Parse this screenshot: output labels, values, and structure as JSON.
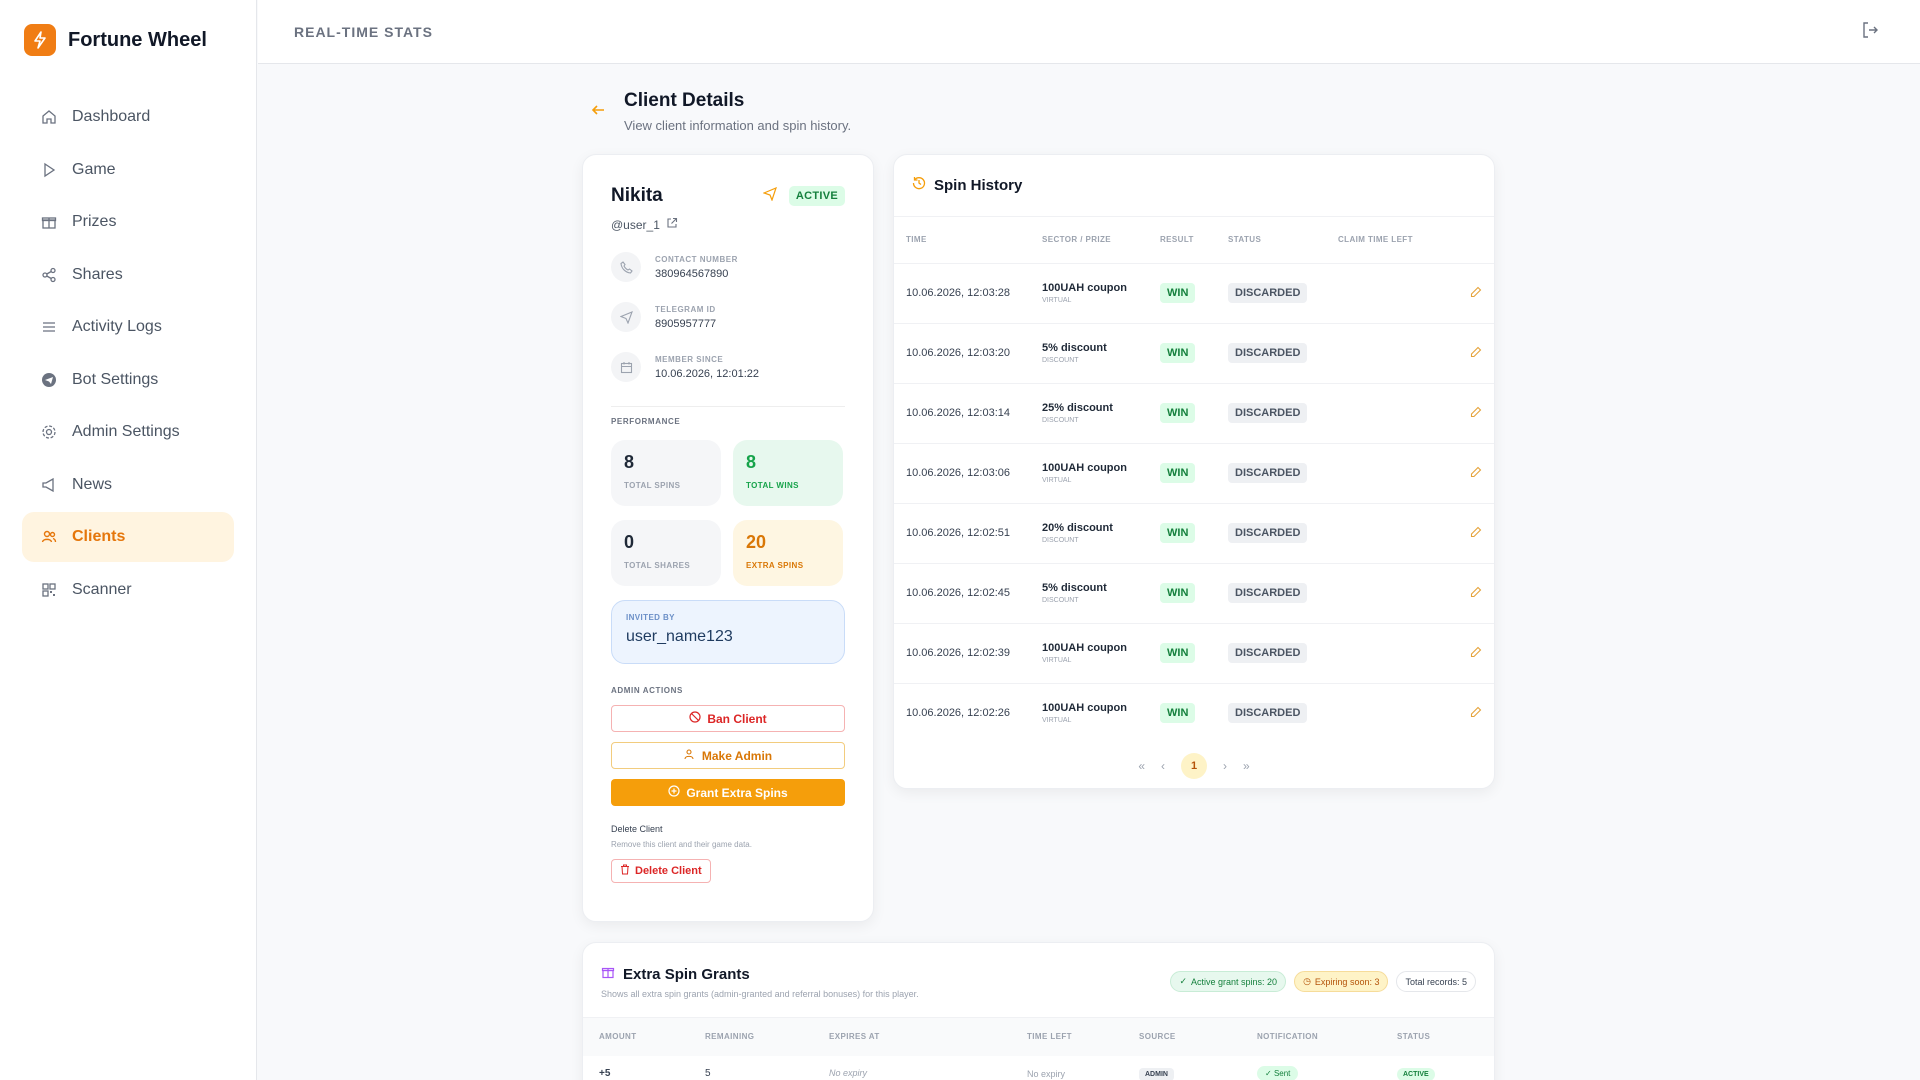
{
  "brand": {
    "name": "Fortune Wheel"
  },
  "sidebar": {
    "items": [
      {
        "label": "Dashboard",
        "icon": "home-icon"
      },
      {
        "label": "Game",
        "icon": "play-icon"
      },
      {
        "label": "Prizes",
        "icon": "gift-icon"
      },
      {
        "label": "Shares",
        "icon": "share-icon"
      },
      {
        "label": "Activity Logs",
        "icon": "list-icon"
      },
      {
        "label": "Bot Settings",
        "icon": "telegram-icon"
      },
      {
        "label": "Admin Settings",
        "icon": "gear-icon"
      },
      {
        "label": "News",
        "icon": "megaphone-icon"
      },
      {
        "label": "Clients",
        "icon": "users-icon",
        "active": true
      },
      {
        "label": "Scanner",
        "icon": "qr-icon"
      }
    ]
  },
  "topbar": {
    "title": "REAL-TIME STATS"
  },
  "page": {
    "title": "Client Details",
    "subtitle": "View client information and spin history."
  },
  "client": {
    "name": "Nikita",
    "status": "ACTIVE",
    "username": "@user_1",
    "contact_label": "CONTACT NUMBER",
    "contact_value": "380964567890",
    "telegram_label": "TELEGRAM ID",
    "telegram_value": "8905957777",
    "member_label": "MEMBER SINCE",
    "member_value": "10.06.2026, 12:01:22",
    "performance_label": "PERFORMANCE",
    "stats": {
      "total_spins": "8",
      "total_spins_label": "TOTAL SPINS",
      "total_wins": "8",
      "total_wins_label": "TOTAL WINS",
      "total_shares": "0",
      "total_shares_label": "TOTAL SHARES",
      "extra_spins": "20",
      "extra_spins_label": "EXTRA SPINS"
    },
    "invited_label": "INVITED BY",
    "invited_value": "user_name123",
    "admin_actions_label": "ADMIN ACTIONS",
    "ban_label": "Ban Client",
    "make_admin_label": "Make Admin",
    "grant_label": "Grant Extra Spins",
    "delete_title": "Delete Client",
    "delete_sub": "Remove this client and their game data.",
    "delete_label": "Delete Client"
  },
  "history": {
    "title": "Spin History",
    "columns": [
      "TIME",
      "SECTOR / PRIZE",
      "RESULT",
      "STATUS",
      "CLAIM TIME LEFT"
    ],
    "rows": [
      {
        "time": "10.06.2026, 12:03:28",
        "prize": "100UAH coupon",
        "type": "VIRTUAL",
        "result": "WIN",
        "status": "DISCARDED"
      },
      {
        "time": "10.06.2026, 12:03:20",
        "prize": "5% discount",
        "type": "DISCOUNT",
        "result": "WIN",
        "status": "DISCARDED"
      },
      {
        "time": "10.06.2026, 12:03:14",
        "prize": "25% discount",
        "type": "DISCOUNT",
        "result": "WIN",
        "status": "DISCARDED"
      },
      {
        "time": "10.06.2026, 12:03:06",
        "prize": "100UAH coupon",
        "type": "VIRTUAL",
        "result": "WIN",
        "status": "DISCARDED"
      },
      {
        "time": "10.06.2026, 12:02:51",
        "prize": "20% discount",
        "type": "DISCOUNT",
        "result": "WIN",
        "status": "DISCARDED"
      },
      {
        "time": "10.06.2026, 12:02:45",
        "prize": "5% discount",
        "type": "DISCOUNT",
        "result": "WIN",
        "status": "DISCARDED"
      },
      {
        "time": "10.06.2026, 12:02:39",
        "prize": "100UAH coupon",
        "type": "VIRTUAL",
        "result": "WIN",
        "status": "DISCARDED"
      },
      {
        "time": "10.06.2026, 12:02:26",
        "prize": "100UAH coupon",
        "type": "VIRTUAL",
        "result": "WIN",
        "status": "DISCARDED"
      }
    ],
    "page": "1"
  },
  "grants": {
    "title": "Extra Spin Grants",
    "subtitle": "Shows all extra spin grants (admin-granted and referral bonuses) for this player.",
    "pill_active": "Active grant spins: 20",
    "pill_expiring": "Expiring soon: 3",
    "pill_total": "Total records: 5",
    "columns": [
      "AMOUNT",
      "REMAINING",
      "EXPIRES AT",
      "TIME LEFT",
      "SOURCE",
      "NOTIFICATION",
      "STATUS"
    ],
    "rows": [
      {
        "amount": "+5",
        "remaining": "5",
        "expires": "No expiry",
        "time_left": "No expiry",
        "source": "ADMIN",
        "notification": "Sent",
        "status": "ACTIVE"
      }
    ]
  }
}
